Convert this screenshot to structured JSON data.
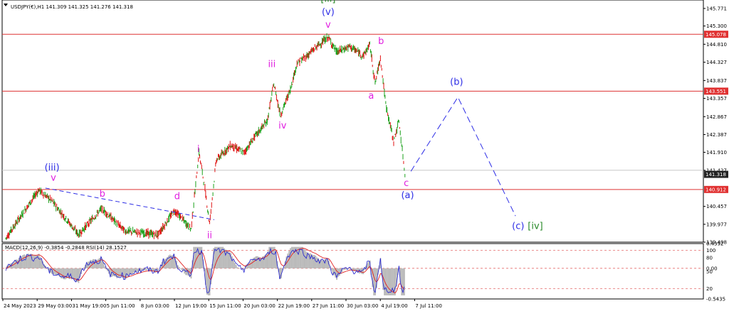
{
  "header": {
    "symbol_info": "USDJPY(€),H1  141.309 141.325 141.276 141.318",
    "macd_info": "MACD(12,26,9) -0.3854 -0.2848  RSI(14) 28.1527"
  },
  "colors": {
    "bull": "#1aa01a",
    "bear": "#e01010",
    "hline": "#dd3333",
    "wave_blue": "#2e2ee6",
    "wave_magenta": "#e020e0",
    "wave_green": "#2a8a2a",
    "macd_hist": "#b8b8b8",
    "macd_line": "#2020d0",
    "signal_line": "#e02020",
    "price_tag": "#222222",
    "level_tag": "#e03030"
  },
  "chart_data": {
    "type": "candlestick",
    "title": "USDJPY(€),H1",
    "ylim": [
      139.498,
      145.998
    ],
    "y_ticks": [
      "145.771",
      "145.300",
      "144.810",
      "144.327",
      "143.837",
      "143.357",
      "142.867",
      "142.387",
      "141.910",
      "141.427",
      "140.457",
      "139.977",
      "139.498"
    ],
    "x_ticks": [
      "24 May 2023",
      "29 May 03:00",
      "31 May 19:00",
      "5 Jun 11:00",
      "8 Jun 03:00",
      "12 Jun 19:00",
      "15 Jun 11:00",
      "20 Jun 03:00",
      "22 Jun 19:00",
      "27 Jun 11:00",
      "30 Jun 03:00",
      "4 Jul 19:00",
      "7 Jul 11:00"
    ],
    "bars_total": 650,
    "price_path": [
      [
        0,
        139.6
      ],
      [
        50,
        140.9
      ],
      [
        70,
        140.6
      ],
      [
        110,
        139.7
      ],
      [
        145,
        140.4
      ],
      [
        180,
        139.8
      ],
      [
        230,
        139.7
      ],
      [
        255,
        140.35
      ],
      [
        280,
        139.85
      ],
      [
        292,
        141.9
      ],
      [
        300,
        141.05
      ],
      [
        308,
        140.0
      ],
      [
        318,
        141.7
      ],
      [
        340,
        142.1
      ],
      [
        360,
        141.9
      ],
      [
        375,
        142.3
      ],
      [
        395,
        142.75
      ],
      [
        405,
        143.75
      ],
      [
        415,
        142.9
      ],
      [
        430,
        143.6
      ],
      [
        440,
        144.3
      ],
      [
        455,
        144.5
      ],
      [
        470,
        144.75
      ],
      [
        487,
        145.0
      ],
      [
        500,
        144.6
      ],
      [
        520,
        144.75
      ],
      [
        540,
        144.5
      ],
      [
        550,
        144.8
      ],
      [
        558,
        143.75
      ],
      [
        566,
        144.45
      ],
      [
        574,
        143.2
      ],
      [
        586,
        142.2
      ],
      [
        594,
        142.75
      ],
      [
        603,
        141.32
      ]
    ],
    "last_price": "141.318",
    "levels": [
      {
        "label": "145.078",
        "value": 145.078
      },
      {
        "label": "143.551",
        "value": 143.551
      },
      {
        "label": "140.912",
        "value": 140.912
      }
    ],
    "gray_level": 141.427,
    "trendline": [
      [
        60,
        140.95
      ],
      [
        315,
        140.1
      ]
    ],
    "projection": [
      [
        612,
        141.4
      ],
      [
        683,
        143.39
      ],
      [
        770,
        140.2
      ]
    ],
    "wave_labels": [
      {
        "text": "[iii]",
        "bar": 487,
        "price": 145.95,
        "color": "green"
      },
      {
        "text": "(v)",
        "bar": 487,
        "price": 145.6,
        "color": "blue"
      },
      {
        "text": "v",
        "bar": 487,
        "price": 145.25,
        "color": "magenta"
      },
      {
        "text": "iii",
        "bar": 402,
        "price": 144.2,
        "color": "magenta"
      },
      {
        "text": "iv",
        "bar": 418,
        "price": 142.55,
        "color": "magenta"
      },
      {
        "text": "i",
        "bar": 291,
        "price": 141.92,
        "color": "magenta"
      },
      {
        "text": "ii",
        "bar": 308,
        "price": 139.6,
        "color": "magenta"
      },
      {
        "text": "d",
        "bar": 259,
        "price": 140.65,
        "color": "magenta"
      },
      {
        "text": "b",
        "bar": 146,
        "price": 140.72,
        "color": "magenta"
      },
      {
        "text": "(iii)",
        "bar": 70,
        "price": 141.42,
        "color": "blue"
      },
      {
        "text": "v",
        "bar": 72,
        "price": 141.15,
        "color": "magenta"
      },
      {
        "text": "b",
        "bar": 567,
        "price": 144.82,
        "color": "magenta"
      },
      {
        "text": "a",
        "bar": 552,
        "price": 143.35,
        "color": "magenta"
      },
      {
        "text": "c",
        "bar": 605,
        "price": 141.0,
        "color": "magenta"
      },
      {
        "text": "(a)",
        "bar": 607,
        "price": 140.68,
        "color": "blue"
      },
      {
        "text": "(b)",
        "bar": 681,
        "price": 143.72,
        "color": "blue"
      },
      {
        "text": "(c)",
        "bar": 774,
        "price": 139.85,
        "color": "blue"
      },
      {
        "text": "[iv]",
        "bar": 800,
        "price": 139.85,
        "color": "green"
      }
    ],
    "indicator": {
      "ylim": [
        -0.5435,
        0.4392
      ],
      "y_ticks": [
        "0.4392",
        "100",
        "80",
        "0.00",
        "50",
        "20",
        "-0.5435"
      ],
      "level_lines": [
        0.32,
        0.0,
        -0.36
      ]
    }
  }
}
